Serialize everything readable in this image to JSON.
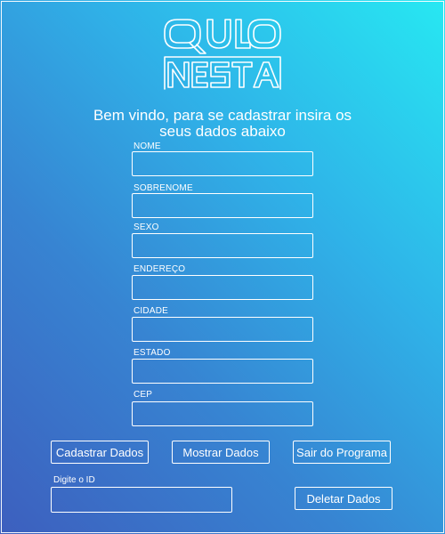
{
  "logo": {
    "text": "QUO NESTA"
  },
  "welcome": {
    "line1": "Bem vindo, para se cadastrar insira os",
    "line2": "seus dados abaixo"
  },
  "fields": {
    "nome": {
      "label": "NOME",
      "value": ""
    },
    "sobrenome": {
      "label": "SOBRENOME",
      "value": ""
    },
    "sexo": {
      "label": "SEXO",
      "value": ""
    },
    "endereco": {
      "label": "ENDEREÇO",
      "value": ""
    },
    "cidade": {
      "label": "CIDADE",
      "value": ""
    },
    "estado": {
      "label": "ESTADO",
      "value": ""
    },
    "cep": {
      "label": "CEP",
      "value": ""
    }
  },
  "buttons": {
    "cadastrar": "Cadastrar Dados",
    "mostrar": "Mostrar Dados",
    "sair": "Sair do Programa",
    "deletar": "Deletar Dados"
  },
  "id_search": {
    "label": "Digite o ID",
    "value": ""
  },
  "colors": {
    "gradient_top_right": "#27e8f2",
    "gradient_bottom_left": "#3d5fbe",
    "foreground": "#ffffff"
  }
}
